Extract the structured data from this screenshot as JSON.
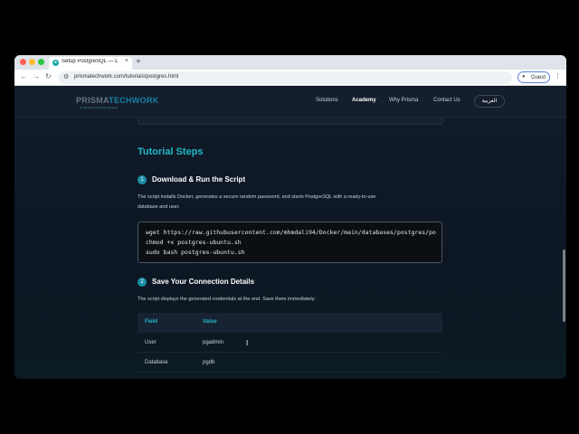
{
  "browser": {
    "tab": {
      "title": "Setup PostgreSQL — Docker",
      "favicon": "globe-icon"
    },
    "url": "prismatechwork.com/tutorials/postgres.html",
    "guest_label": "Guest"
  },
  "site": {
    "logo": {
      "part1": "PR",
      "part2": "ISMA",
      "part3": "TECHWORK",
      "tagline": "IT Network & Security Solutions"
    },
    "nav": [
      {
        "label": "Solutions"
      },
      {
        "label": "Academy"
      },
      {
        "label": "Why Prisma"
      },
      {
        "label": "Contact Us"
      }
    ],
    "lang_button": "العربية"
  },
  "content": {
    "section_title": "Tutorial Steps",
    "step1": {
      "number": "1",
      "title": "Download & Run the Script",
      "description_line1": "The script installs Docker, generates a secure random password, and starts PostgreSQL with a ready-to-use",
      "description_line2": "database and user.",
      "code": [
        "wget https://raw.githubusercontent.com/mhmdali94/Docker/main/databases/postgres/po",
        "chmod +x postgres-ubuntu.sh",
        "sudo bash postgres-ubuntu.sh"
      ]
    },
    "step2": {
      "number": "2",
      "title": "Save Your Connection Details",
      "description": "The script displays the generated credentials at the end. Save them immediately:",
      "table": {
        "headers": [
          "Field",
          "Value"
        ],
        "rows": [
          [
            "User",
            "pgadmin"
          ],
          [
            "Database",
            "pgdb"
          ]
        ]
      }
    }
  },
  "colors": {
    "accent": "#21b8c4",
    "background": "#0d1520",
    "nav_bg": "#141e2c"
  }
}
